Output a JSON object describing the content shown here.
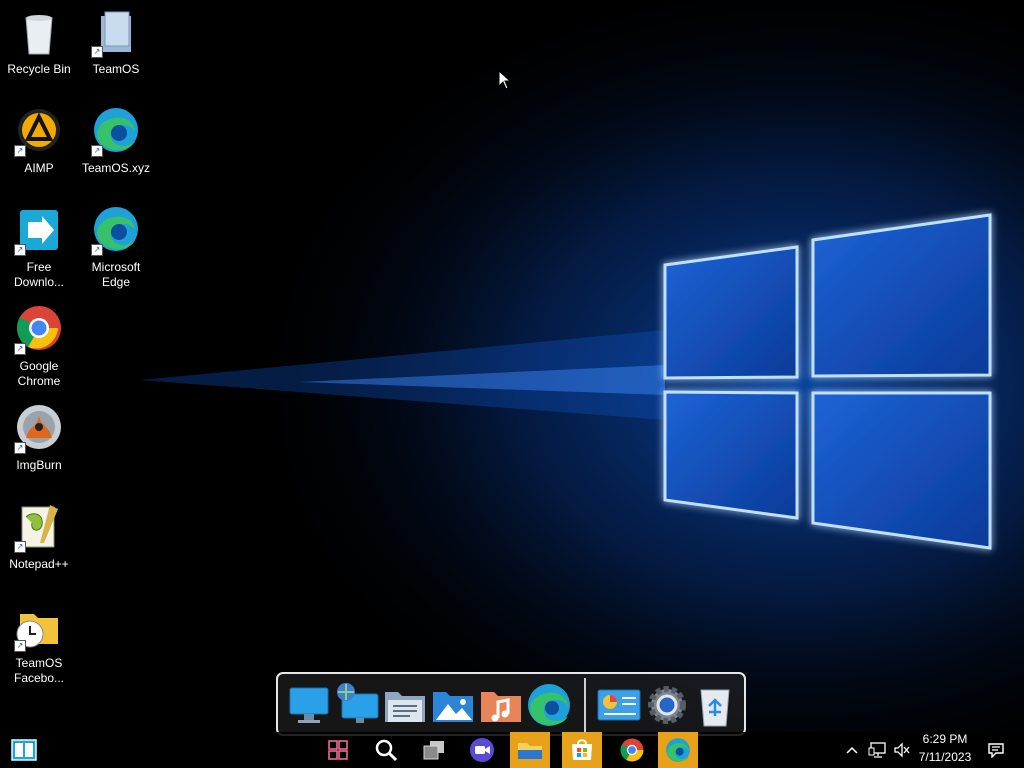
{
  "desktop": {
    "icons": [
      {
        "label_1": "Recycle Bin",
        "label_2": "",
        "icon": "recycle-bin-icon"
      },
      {
        "label_1": "TeamOS",
        "label_2": "",
        "icon": "teamos-folder-icon"
      },
      {
        "label_1": "AIMP",
        "label_2": "",
        "icon": "aimp-icon"
      },
      {
        "label_1": "TeamOS.xyz",
        "label_2": "",
        "icon": "edge-icon"
      },
      {
        "label_1": "Free",
        "label_2": "Downlo...",
        "icon": "free-download-manager-icon"
      },
      {
        "label_1": "Microsoft",
        "label_2": "Edge",
        "icon": "edge-icon"
      },
      {
        "label_1": "Google",
        "label_2": "Chrome",
        "icon": "chrome-icon"
      },
      {
        "label_1": "ImgBurn",
        "label_2": "",
        "icon": "imgburn-icon"
      },
      {
        "label_1": "Notepad++",
        "label_2": "",
        "icon": "notepadpp-icon"
      },
      {
        "label_1": "TeamOS",
        "label_2": "Facebo...",
        "icon": "folder-clock-icon"
      }
    ]
  },
  "dock": {
    "items": [
      "monitor-icon",
      "network-monitor-icon",
      "documents-folder-icon",
      "pictures-folder-icon",
      "music-folder-icon",
      "edge-icon",
      "control-panel-icon",
      "settings-gear-icon",
      "recycle-bin-icon"
    ]
  },
  "taskbar": {
    "start_icon": "start-icon",
    "buttons": [
      "widgets-icon",
      "search-icon",
      "task-view-icon",
      "meet-icon",
      "file-explorer-icon",
      "store-icon",
      "chrome-icon",
      "edge-icon"
    ],
    "active_color": "#e8a21a",
    "tray": {
      "time": "6:29 PM",
      "date": "7/11/2023"
    }
  },
  "colors": {
    "glow_blue": "#2a7fff",
    "window_pane": "#1f6fe0"
  }
}
